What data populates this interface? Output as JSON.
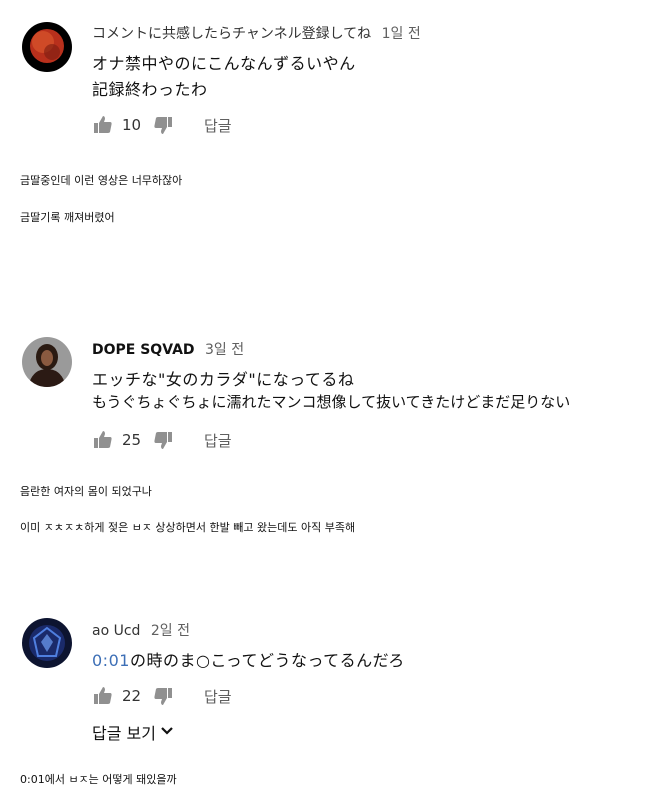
{
  "comments": [
    {
      "author": "コメントに共感したらチャンネル登録してね",
      "time": "1일 전",
      "lines": [
        "オナ禁中やのにこんなんずるいやん",
        "記録終わったわ"
      ],
      "likes": "10",
      "reply_label": "답글",
      "translations": [
        "금딸중인데 이런 영상은 너무하잖아",
        "금딸기록 깨져버렸어"
      ]
    },
    {
      "author": "DOPE SQVAD",
      "time": "3일 전",
      "lines": [
        "エッチな\"女のカラダ\"になってるね",
        "もうぐちょぐちょに濡れたマンコ想像して抜いてきたけどまだ足りない"
      ],
      "likes": "25",
      "reply_label": "답글",
      "translations": [
        "음란한 여자의 몸이 되었구나",
        "이미 ㅈㅊㅈㅊ하게 젖은 ㅂㅈ 상상하면서 한발 빼고 왔는데도 아직 부족해"
      ]
    },
    {
      "author": "ao Ucd",
      "time": "2일 전",
      "timestamp_link": "0:01",
      "lines": [
        "の時のま○こってどうなってるんだろ"
      ],
      "likes": "22",
      "reply_label": "답글",
      "view_replies_label": "답글 보기",
      "translations": [
        "0:01에서 ㅂㅈ는 어떻게 돼있을까"
      ]
    }
  ],
  "icons": {
    "like": "thumbs-up-icon",
    "dislike": "thumbs-down-icon",
    "expand": "chevron-down-icon"
  },
  "colors": {
    "link": "#3d6fb6",
    "muted": "#606060",
    "icon": "#909090"
  }
}
